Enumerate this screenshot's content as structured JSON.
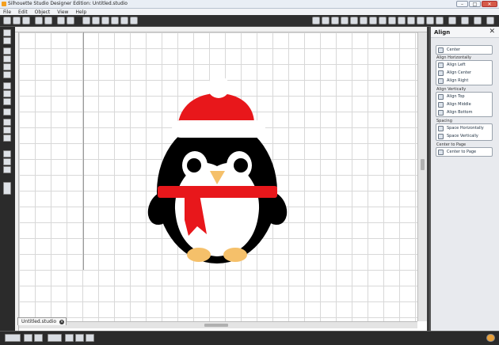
{
  "window": {
    "title": "Silhouette Studio Designer Edition: Untitled.studio"
  },
  "menu": [
    "File",
    "Edit",
    "Object",
    "View",
    "Help"
  ],
  "document": {
    "tab_label": "Untitled.studio"
  },
  "panel": {
    "title": "Align",
    "top_button": "Center",
    "sections": [
      {
        "label": "Align Horizontally",
        "buttons": [
          "Align Left",
          "Align Center",
          "Align Right"
        ]
      },
      {
        "label": "Align Vertically",
        "buttons": [
          "Align Top",
          "Align Middle",
          "Align Bottom"
        ]
      },
      {
        "label": "Spacing",
        "buttons": [
          "Space Horizontally",
          "Space Vertically"
        ]
      },
      {
        "label": "Center to Page",
        "buttons": [
          "Center to Page"
        ]
      }
    ]
  },
  "artwork": {
    "subject": "penguin with santa hat and red scarf",
    "colors": {
      "hat": "#e8171b",
      "scarf": "#e8171b",
      "body": "#000000",
      "belly": "#ffffff",
      "beak": "#f5c06a",
      "feet": "#f5c06a"
    }
  }
}
